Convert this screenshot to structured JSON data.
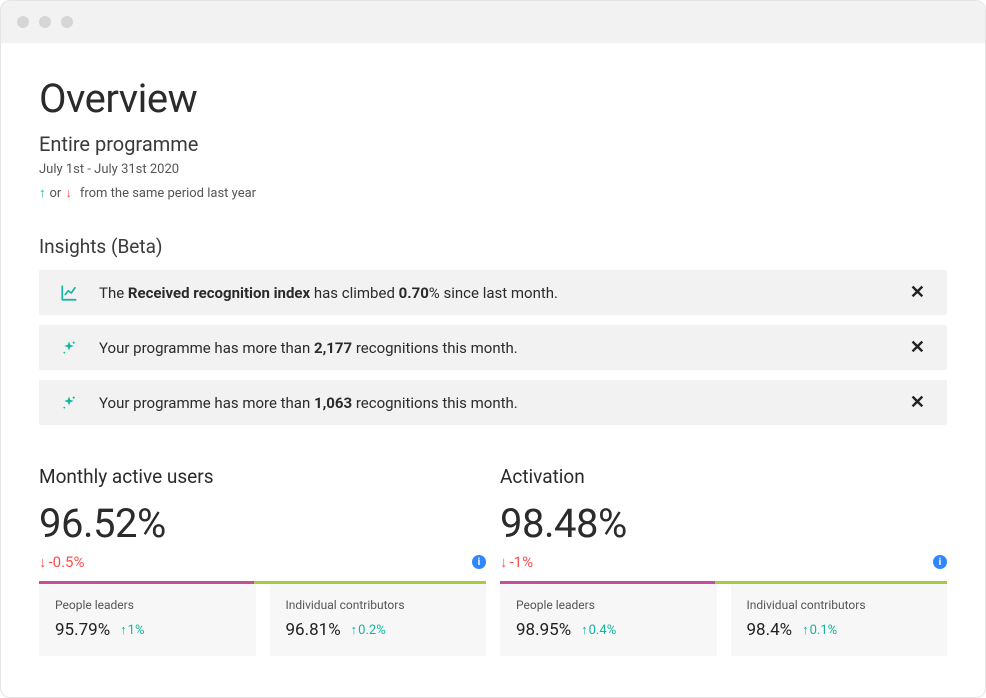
{
  "header": {
    "title": "Overview",
    "subtitle": "Entire programme",
    "date_range": "July 1st - July 31st 2020",
    "legend_or": "or",
    "legend_tail": "from the same period last year"
  },
  "insights": {
    "heading": "Insights (Beta)",
    "items": [
      {
        "icon": "chart-line",
        "prefix": "The ",
        "bold1": "Received recognition index",
        "mid": " has climbed ",
        "bold2": "0.70",
        "suffix": "% since last month."
      },
      {
        "icon": "sparkle",
        "prefix": "Your programme has more than ",
        "bold1": "2,177",
        "mid": "",
        "bold2": "",
        "suffix": " recognitions this month."
      },
      {
        "icon": "sparkle",
        "prefix": "Your programme has more than ",
        "bold1": "1,063",
        "mid": "",
        "bold2": "",
        "suffix": " recognitions this month."
      }
    ]
  },
  "metrics": [
    {
      "title": "Monthly active users",
      "value": "96.52%",
      "delta": "-0.5%",
      "delta_dir": "down",
      "bar_split": 48,
      "breakdown": [
        {
          "label": "People leaders",
          "value": "95.79%",
          "delta": "1%",
          "dir": "up"
        },
        {
          "label": "Individual contributors",
          "value": "96.81%",
          "delta": "0.2%",
          "dir": "up"
        }
      ]
    },
    {
      "title": "Activation",
      "value": "98.48%",
      "delta": "-1%",
      "delta_dir": "down",
      "bar_split": 48,
      "breakdown": [
        {
          "label": "People leaders",
          "value": "98.95%",
          "delta": "0.4%",
          "dir": "up"
        },
        {
          "label": "Individual contributors",
          "value": "98.4%",
          "delta": "0.1%",
          "dir": "up"
        }
      ]
    }
  ],
  "colors": {
    "teal": "#13b5a2",
    "red": "#ff4b4b",
    "pink": "#c94b9b",
    "green": "#a6cc3e"
  }
}
